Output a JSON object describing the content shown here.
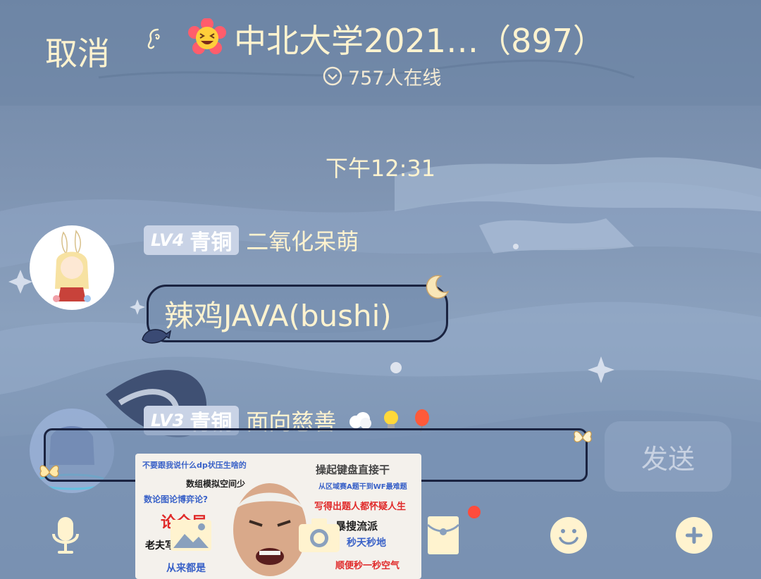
{
  "header": {
    "cancel_label": "取消",
    "group_title": "中北大学2021…（897）",
    "online_status": "757人在线",
    "icons": [
      "ear-icon",
      "laughing-flower-emoji",
      "chevron-down-circle-icon"
    ]
  },
  "chat": {
    "timestamp": "下午12:31",
    "messages": [
      {
        "level": "LV4",
        "rank": "青铜",
        "nickname": "二氧化呆萌",
        "text": "辣鸡JAVA(bushi)"
      },
      {
        "level": "LV3",
        "rank": "青铜",
        "nickname": "面向慈善",
        "emojis": [
          "cloud-emoji",
          "lightbulb-emoji",
          "balloon-emoji"
        ]
      }
    ]
  },
  "composer": {
    "input_value": "",
    "send_label": "发送"
  },
  "meme_sticker": {
    "lines_left": [
      "不要跟我说什么dp状压生啥的",
      "数组模拟空间少",
      "数论图论博弈论?",
      "论全局",
      "老夫写算法",
      "从来都是"
    ],
    "lines_right": [
      "操起键盘直接干",
      "从区域赛A题干到WF最难题",
      "写得出题人都怀疑人生",
      "暴搜流派",
      "秒天秒地",
      "顺便秒一秒空气"
    ]
  },
  "toolbar": {
    "items": [
      "microphone-icon",
      "image-icon",
      "camera-icon",
      "red-packet-icon",
      "emoji-icon",
      "plus-icon"
    ],
    "notification": true
  },
  "colors": {
    "accent_text": "#fff3cf",
    "bubble_border": "#1a2340",
    "notification_dot": "#ff4c3c"
  }
}
